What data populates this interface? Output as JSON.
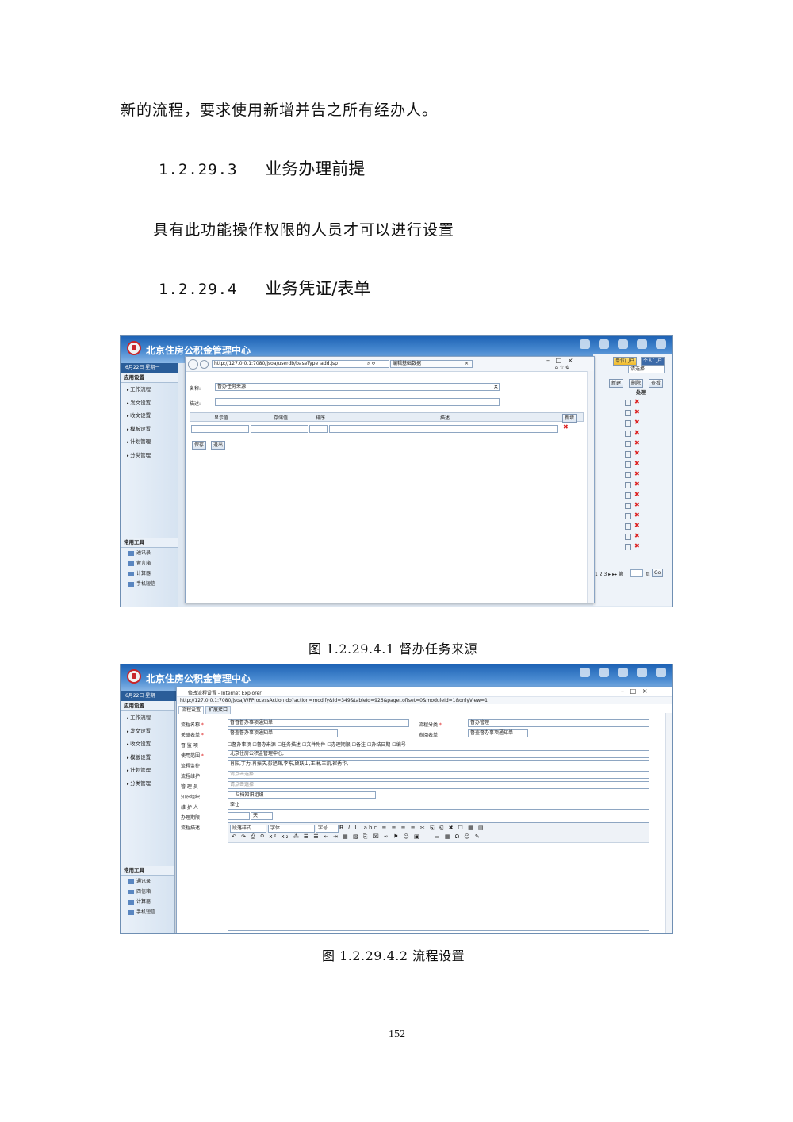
{
  "text": {
    "line1": "新的流程，要求使用新增并告之所有经办人。",
    "h1_num": "1.2.29.3",
    "h1_title": "业务办理前提",
    "para2": "具有此功能操作权限的人员才可以进行设置",
    "h2_num": "1.2.29.4",
    "h2_title": "业务凭证/表单",
    "caption1": "图 1.2.29.4.1 督办任务来源",
    "caption2": "图 1.2.29.4.2 流程设置",
    "page_number": "152"
  },
  "fig1": {
    "app_title": "北京住房公积金管理中心",
    "date_bar": "6月22日 星期一",
    "sidebar_header": "应用设置",
    "menu": [
      "工作流程",
      "发文设置",
      "收文设置",
      "模板设置",
      "计划管理",
      "分类管理"
    ],
    "tools_header": "常用工具",
    "tools": [
      "通讯录",
      "留言箱",
      "计算器",
      "手机短信"
    ],
    "top_buttons": [
      "单位门户",
      "个人门户"
    ],
    "select_value": "请选择",
    "action_buttons": [
      "新建",
      "删除",
      "查看"
    ],
    "col_header": "处理",
    "pager_text": "1 2 3 ▸ ▸▸ 第",
    "pager_unit": "页",
    "pager_go": "Go",
    "url": "http://127.0.0.1:7080/jsoa/userdb/baseType_add.jsp",
    "tab_label": "编辑基础数据",
    "name_label": "名称:",
    "name_value": "督办任务来源",
    "desc_label": "描述:",
    "cols": [
      "显示值",
      "存储值",
      "排序",
      "描述"
    ],
    "new_btn": "新增",
    "save_btn": "保存",
    "exit_btn": "退出"
  },
  "fig2": {
    "app_title": "北京住房公积金管理中心",
    "date_bar": "6月22日 星期一",
    "sidebar_header": "应用设置",
    "menu": [
      "工作流程",
      "发文设置",
      "收文设置",
      "模板设置",
      "计划管理",
      "分类管理"
    ],
    "tools_header": "常用工具",
    "tools": [
      "通讯录",
      "西信箱",
      "计算器",
      "手机短信"
    ],
    "window_title": "修改流程设置 - Internet Explorer",
    "url": "http://127.0.0.1:7080/jsoa/WFProcessAction.do?action=modify&id=349&tableId=926&pager.offset=0&moduleId=1&onlyView=1",
    "tabs": [
      "流程设置",
      "扩展接口"
    ],
    "labels": {
      "name": "流程名称",
      "form": "关联表单",
      "option": "督 监 项",
      "scope": "使用范围",
      "monitor": "流程监控",
      "maintain": "流程维护",
      "manager": "管 理 员",
      "dept": "知识组织",
      "keeper": "维 护 人",
      "deadline": "办理期限",
      "desc": "流程描述",
      "category": "流程分类",
      "query": "查阅表单"
    },
    "values": {
      "name": "督督督办事项通知单",
      "form": "督查督办事项通知单",
      "scope": "北京住房公积金管理中心,",
      "monitor": "肖阳,丁力,肖振庆,彭旭辉,李东,顾跃山,王琳,王凯,崔秀华,",
      "maintain_ph": "请点击选择",
      "manager_ph": "请点击选择",
      "dept": "---归档知识组织---",
      "keeper": "李让",
      "deadline_unit": "天",
      "category": "督办管理",
      "query": "督查督办事项通知单"
    },
    "checks": [
      "督办事项",
      "督办来源",
      "任务描述",
      "文件附件",
      "办理期限",
      "备注",
      "办结日期",
      "编号"
    ],
    "editor_selects": [
      "段落样式",
      "字体",
      "字号"
    ]
  }
}
